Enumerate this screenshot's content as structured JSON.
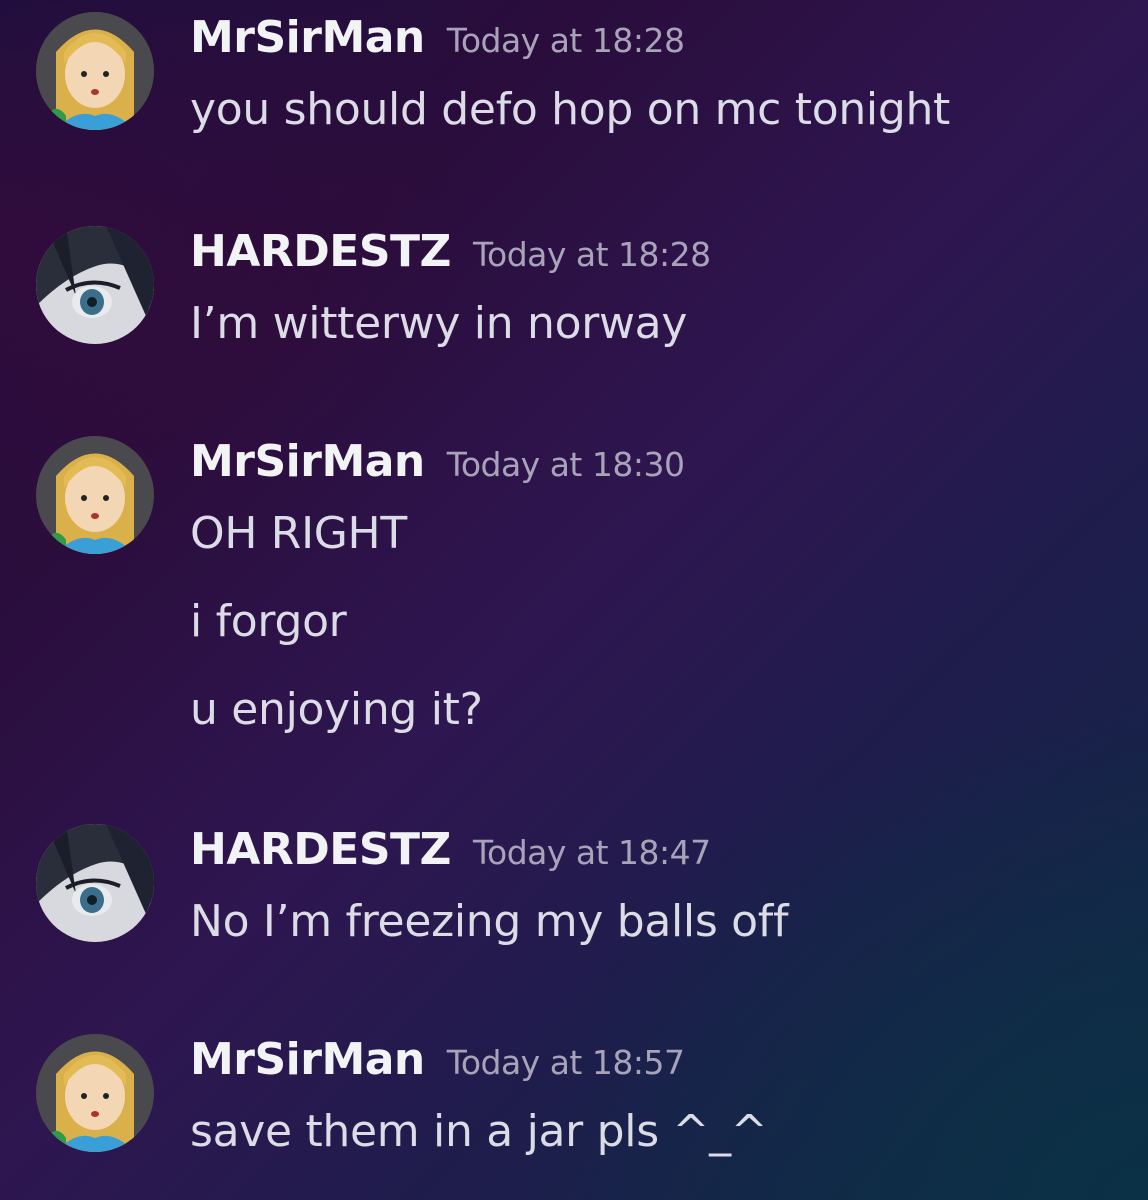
{
  "messages": [
    {
      "username": "MrSirMan",
      "timestamp": "Today at 18:28",
      "avatar": "blonde-girl-avatar",
      "lines": [
        "you should defo hop on mc tonight"
      ]
    },
    {
      "username": "HARDESTZ",
      "timestamp": "Today at 18:28",
      "avatar": "dark-hair-anime-avatar",
      "lines": [
        "I’m witterwy in norway"
      ]
    },
    {
      "username": "MrSirMan",
      "timestamp": "Today at 18:30",
      "avatar": "blonde-girl-avatar",
      "lines": [
        "OH RIGHT",
        "i forgor",
        "u enjoying it?"
      ]
    },
    {
      "username": "HARDESTZ",
      "timestamp": "Today at 18:47",
      "avatar": "dark-hair-anime-avatar",
      "lines": [
        "No I’m freezing my balls off"
      ]
    },
    {
      "username": "MrSirMan",
      "timestamp": "Today at 18:57",
      "avatar": "blonde-girl-avatar",
      "lines": [
        "save them in a jar pls ^_^"
      ]
    }
  ],
  "colors": {
    "username": "#f2f3f5",
    "timestamp": "#a8a3b8",
    "message": "#dcdce6"
  }
}
